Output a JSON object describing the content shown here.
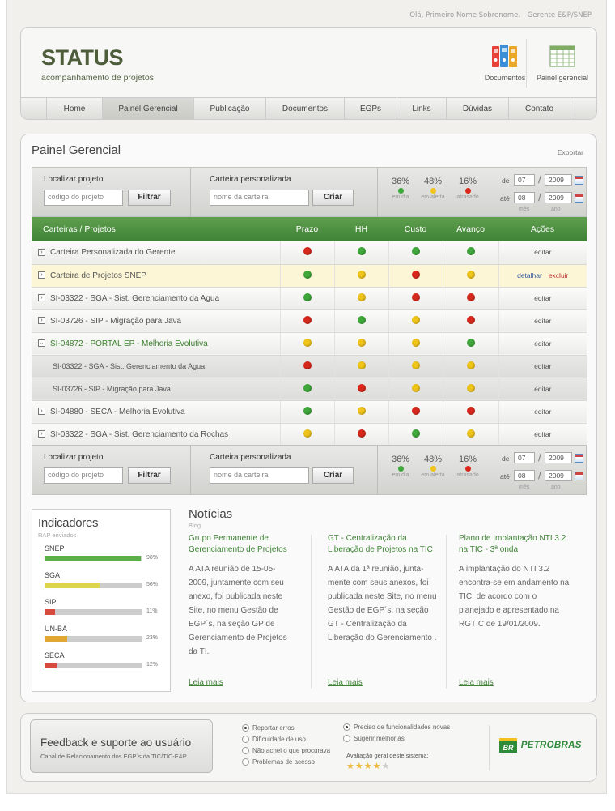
{
  "topbar": {
    "greeting": "Olá, Primeiro Nome Sobrenome.",
    "role": "Gerente E&P/SNEP"
  },
  "logo": {
    "title": "STATUS",
    "subtitle": "acompanhamento de projetos"
  },
  "header_icons": [
    {
      "icon": "binders-icon",
      "label": "Documentos"
    },
    {
      "icon": "spreadsheet-icon",
      "label": "Painel gerencial"
    }
  ],
  "nav": [
    {
      "label": "Home",
      "active": false
    },
    {
      "label": "Painel Gerencial",
      "active": true
    },
    {
      "label": "Publicação",
      "active": false
    },
    {
      "label": "Documentos",
      "active": false
    },
    {
      "label": "EGPs",
      "active": false
    },
    {
      "label": "Links",
      "active": false
    },
    {
      "label": "Dúvidas",
      "active": false
    },
    {
      "label": "Contato",
      "active": false
    }
  ],
  "page": {
    "title": "Painel Gerencial",
    "export": "Exportar"
  },
  "filter": {
    "project_label": "Localizar projeto",
    "project_placeholder": "código do  projeto",
    "filter_button": "Filtrar",
    "wallet_label": "Carteira personalizada",
    "wallet_placeholder": "nome da carteira",
    "create_button": "Criar",
    "stats": [
      {
        "value": "36%",
        "label": "em dia",
        "color": "#3ea83a"
      },
      {
        "value": "48%",
        "label": "em alerta",
        "color": "#f0c419"
      },
      {
        "value": "16%",
        "label": "atrasado",
        "color": "#d8281c"
      }
    ],
    "from_label": "de",
    "to_label": "até",
    "from_month": "07",
    "from_year": "2009",
    "to_month": "08",
    "to_year": "2009",
    "month_label": "mês",
    "year_label": "ano"
  },
  "colors": {
    "green": "#3ea83a",
    "yellow": "#f0c419",
    "red": "#d8281c",
    "accent": "#3f8236"
  },
  "table": {
    "headers": [
      "Carteiras / Projetos",
      "Prazo",
      "HH",
      "Custo",
      "Avanço",
      "Ações"
    ],
    "edit_label": "editar",
    "detail_label": "detalhar",
    "delete_label": "excluir",
    "rows": [
      {
        "name": "Carteira Personalizada do Gerente",
        "toggle": "›",
        "status": [
          "red",
          "green",
          "green",
          "green"
        ],
        "type": "normal"
      },
      {
        "name": "Carteira de Projetos SNEP",
        "toggle": "›",
        "status": [
          "green",
          "yellow",
          "red",
          "yellow"
        ],
        "type": "highlight"
      },
      {
        "name": "SI-03322 - SGA - Sist. Gerenciamento da Agua",
        "toggle": "›",
        "status": [
          "green",
          "yellow",
          "red",
          "red"
        ],
        "type": "normal"
      },
      {
        "name": "SI-03726 - SIP - Migração para Java",
        "toggle": "›",
        "status": [
          "red",
          "green",
          "yellow",
          "red"
        ],
        "type": "normal"
      },
      {
        "name": "SI-04872 - PORTAL EP - Melhoria Evolutiva",
        "toggle": "⌄",
        "status": [
          "yellow",
          "yellow",
          "yellow",
          "green"
        ],
        "type": "open"
      },
      {
        "name": "SI-03322 - SGA - Sist. Gerenciamento da Agua",
        "toggle": "",
        "status": [
          "red",
          "yellow",
          "yellow",
          "yellow"
        ],
        "type": "child"
      },
      {
        "name": "SI-03726 - SIP - Migração para Java",
        "toggle": "",
        "status": [
          "green",
          "red",
          "yellow",
          "yellow"
        ],
        "type": "child"
      },
      {
        "name": "SI-04880 - SECA - Melhoria Evolutiva",
        "toggle": "›",
        "status": [
          "green",
          "yellow",
          "red",
          "red"
        ],
        "type": "normal"
      },
      {
        "name": "SI-03322 - SGA - Sist. Gerenciamento da Rochas",
        "toggle": "›",
        "status": [
          "yellow",
          "red",
          "green",
          "yellow"
        ],
        "type": "normal"
      }
    ]
  },
  "indicators": {
    "title": "Indicadores",
    "subtitle": "RAP enviados",
    "items": [
      {
        "name": "SNEP",
        "percent": 98,
        "label": "98%",
        "color": "#5cb04a"
      },
      {
        "name": "SGA",
        "percent": 56,
        "label": "56%",
        "color": "#dcd44a"
      },
      {
        "name": "SIP",
        "percent": 11,
        "label": "11%",
        "color": "#d84a3f"
      },
      {
        "name": "UN-BA",
        "percent": 23,
        "label": "23%",
        "color": "#e0a733"
      },
      {
        "name": "SECA",
        "percent": 12,
        "label": "12%",
        "color": "#d84a3f"
      }
    ]
  },
  "news": {
    "title": "Notícias",
    "subtitle": "Blog",
    "more_label": "Leia mais",
    "items": [
      {
        "headline": "Grupo Permanente de Gerenciamento de Projetos",
        "body": "A ATA reunião de 15-05-2009, juntamente com seu anexo, foi publicada neste Site, no menu Gestão de EGP´s, na seção GP de Gerenciamento de Projetos da TI."
      },
      {
        "headline": "GT - Centralização da Liberação de Projetos na TIC",
        "body": "A ATA da 1ª reunião, junta-mente com seus anexos, foi publicada neste Site, no menu Gestão de EGP´s, na seção GT - Centralização da Liberação  do Gerenciamento ."
      },
      {
        "headline": "Plano de Implantação NTI 3.2 na TIC - 3ª onda",
        "body": "A implantação do NTI 3.2 encontra-se em andamento na TIC, de acordo com o planejado e apresentado na RGTIC de 19/01/2009."
      }
    ]
  },
  "footer": {
    "title": "Feedback e suporte ao usuário",
    "subtitle": "Canal de Relacionamento dos EGP´s da TIC/TIC-E&P",
    "options_left": [
      {
        "label": "Reportar erros",
        "selected": true
      },
      {
        "label": "Dificuldade de uso",
        "selected": false
      },
      {
        "label": "Não achei o que procurava",
        "selected": false
      },
      {
        "label": "Problemas de acesso",
        "selected": false
      }
    ],
    "options_right": [
      {
        "label": "Preciso de funcionalidades novas",
        "selected": true
      },
      {
        "label": "Sugerir melhorias",
        "selected": false
      }
    ],
    "rating_label": "Avaliação geral deste sistema:",
    "rating": 4,
    "rating_max": 5,
    "brand_badge": "BR",
    "brand": "PETROBRAS"
  }
}
